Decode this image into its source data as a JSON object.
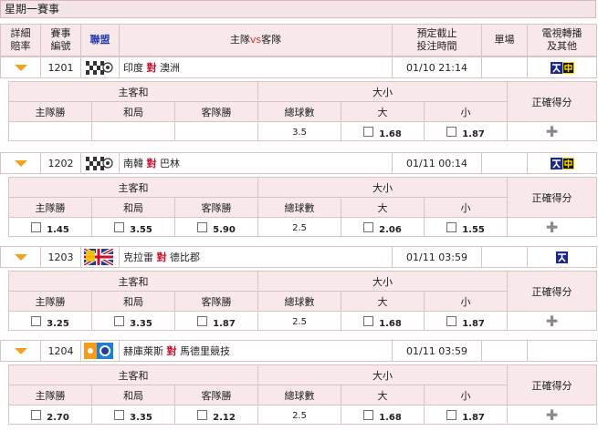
{
  "page_title": "星期一賽事",
  "header": {
    "detail_odds": "詳細\n賠率",
    "match_no": "賽事\n編號",
    "league": "聯盟",
    "home": "主隊",
    "vs": "vs",
    "away": "客隊",
    "deadline": "預定截止\n投注時間",
    "single": "單場",
    "tv": "電視轉播\n及其他"
  },
  "odds_header": {
    "home_away": "主客和",
    "over_under": "大小",
    "correct_score": "正確得分",
    "home_win": "主隊勝",
    "draw": "和局",
    "away_win": "客隊勝",
    "total_goals": "總球數",
    "big": "大",
    "small": "小"
  },
  "vs_word": "對",
  "matches": [
    {
      "no": "1201",
      "home": "印度",
      "away": "澳洲",
      "time": "01/10 21:14",
      "league_icon": "checker-flag-icon",
      "tv": [
        "channel-a-icon",
        "channel-b-icon"
      ],
      "odds": {
        "home_win": "",
        "draw": "",
        "away_win": "",
        "total": "3.5",
        "big": "1.68",
        "small": "1.87"
      }
    },
    {
      "no": "1202",
      "home": "南韓",
      "away": "巴林",
      "time": "01/11 00:14",
      "league_icon": "checker-flag-icon",
      "tv": [
        "channel-a-icon",
        "channel-b-icon"
      ],
      "odds": {
        "home_win": "1.45",
        "draw": "3.55",
        "away_win": "5.90",
        "total": "2.5",
        "big": "2.06",
        "small": "1.55"
      }
    },
    {
      "no": "1203",
      "home": "克拉雷",
      "away": "德比郡",
      "time": "01/11 03:59",
      "league_icon": "england-flag-icon",
      "tv": [
        "channel-a-icon"
      ],
      "odds": {
        "home_win": "3.25",
        "draw": "3.35",
        "away_win": "1.87",
        "total": "2.5",
        "big": "1.68",
        "small": "1.87"
      }
    },
    {
      "no": "1204",
      "home": "赫庫萊斯",
      "away": "馬德里競技",
      "time": "01/11 03:59",
      "league_icon": "spain-flag-icon",
      "tv": [],
      "odds": {
        "home_win": "2.70",
        "draw": "3.35",
        "away_win": "2.12",
        "total": "2.5",
        "big": "1.68",
        "small": "1.87"
      }
    }
  ]
}
